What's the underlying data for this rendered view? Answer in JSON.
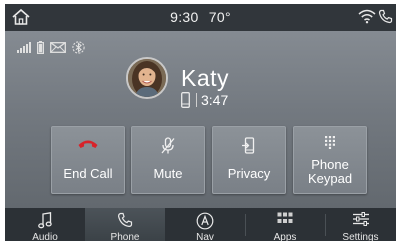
{
  "topbar": {
    "time": "9:30",
    "temperature": "70°"
  },
  "status_icons": [
    "signal-icon",
    "battery-icon",
    "message-icon",
    "bluetooth-icon"
  ],
  "call": {
    "caller_name": "Katy",
    "duration": "3:47",
    "device_icon": "mobile-phone-icon"
  },
  "actions": [
    {
      "label": "End Call",
      "icon": "end-call-icon",
      "accent": "#d8232a"
    },
    {
      "label": "Mute",
      "icon": "mute-mic-icon"
    },
    {
      "label": "Privacy",
      "icon": "privacy-icon"
    },
    {
      "label_line1": "Phone",
      "label_line2": "Keypad",
      "icon": "keypad-icon"
    }
  ],
  "nav": {
    "items": [
      {
        "label": "Audio",
        "icon": "music-note-icon"
      },
      {
        "label": "Phone",
        "icon": "phone-icon",
        "active": true
      },
      {
        "label": "Nav",
        "icon": "navigation-icon"
      },
      {
        "label": "Apps",
        "icon": "apps-grid-icon"
      },
      {
        "label": "Settings",
        "icon": "settings-sliders-icon"
      }
    ]
  }
}
